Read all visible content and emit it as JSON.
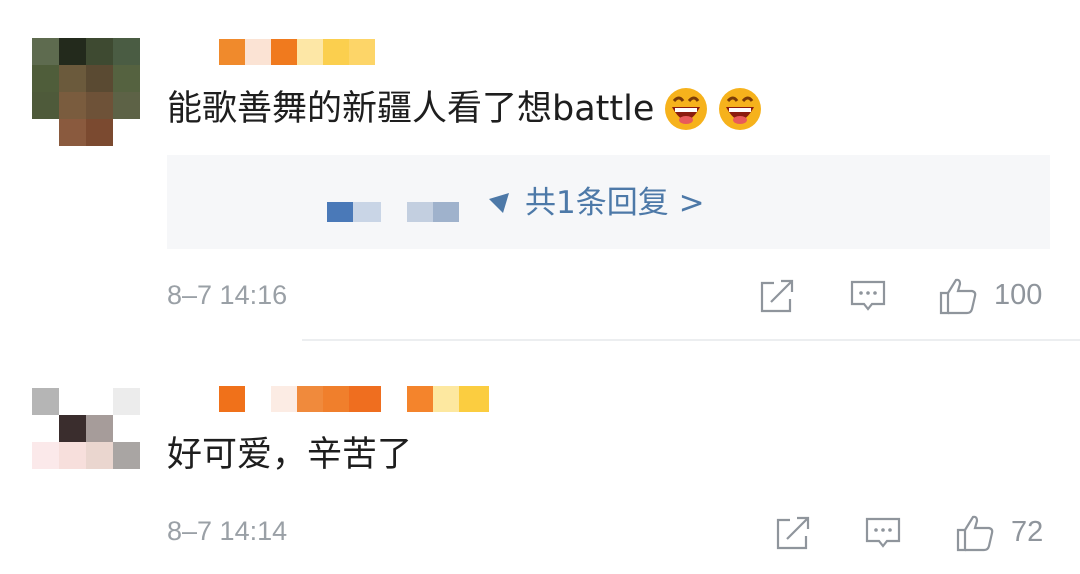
{
  "comments": [
    {
      "text": "能歌善舞的新疆人看了想battle",
      "emoji": [
        "grinning-face-emoji",
        "grinning-face-emoji"
      ],
      "reply_link": "共1条回复 >",
      "time": "8–7 14:16",
      "likes": "100"
    },
    {
      "text": "好可爱，辛苦了",
      "time": "8–7 14:14",
      "likes": "72"
    }
  ],
  "icons": {
    "share": "share-icon",
    "comment": "comment-icon",
    "like": "thumbs-up-icon",
    "reply_arrow": "triangle-arrow-icon"
  },
  "colors": {
    "link": "#4d79a8",
    "meta": "#9aa0a6",
    "reply_bg": "#f6f7f9"
  }
}
